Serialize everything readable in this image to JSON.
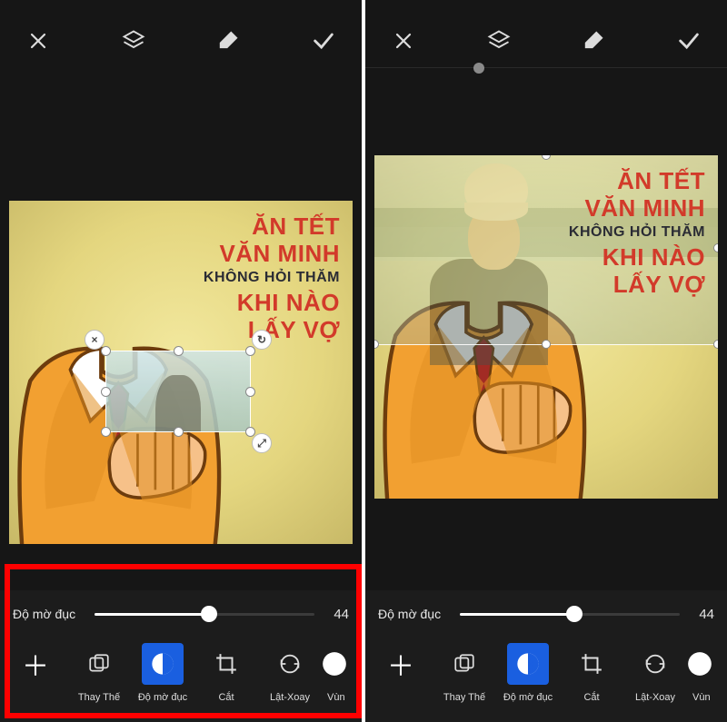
{
  "meme_text": {
    "line1": "ĂN TẾT",
    "line2": "VĂN MINH",
    "line3": "KHÔNG HỎI THĂM",
    "line4": "KHI NÀO",
    "line5": "LẤY VỢ"
  },
  "slider": {
    "label": "Độ mờ đục",
    "value": "44",
    "percent": 44
  },
  "tools": {
    "replace": "Thay Thế",
    "opacity": "Độ mờ đục",
    "crop": "Cắt",
    "fliprot": "Lật-Xoay",
    "region": "Vùn"
  },
  "icons": {
    "close": "close-icon",
    "layers": "layers-icon",
    "eraser": "eraser-icon",
    "confirm": "check-icon",
    "plus": "plus-icon",
    "replace": "replace-icon",
    "opacity": "opacity-icon",
    "crop": "crop-icon",
    "fliprot": "fliprot-icon",
    "region": "region-icon",
    "sel_close": "×",
    "sel_rotate": "↻",
    "sel_scale": "⤢"
  }
}
